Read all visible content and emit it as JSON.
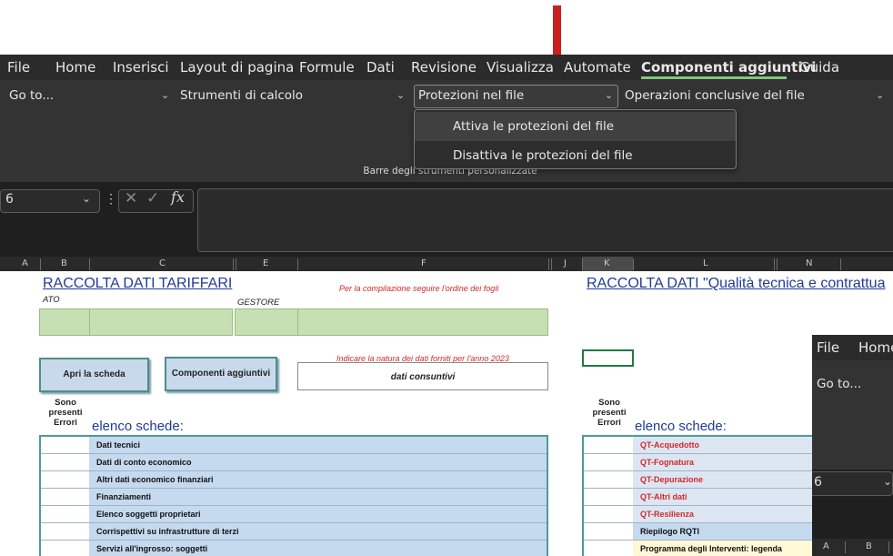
{
  "menubar": {
    "items": [
      "File",
      "Home",
      "Inserisci",
      "Layout di pagina",
      "Formule",
      "Dati",
      "Revisione",
      "Visualizza",
      "Automate",
      "Componenti aggiuntivi",
      "Guida"
    ],
    "active": "Componenti aggiuntivi"
  },
  "ribbon": {
    "dropdowns": [
      "Go to...",
      "Strumenti di calcolo",
      "Protezioni nel file",
      "Operazioni conclusive del file"
    ],
    "group_label": "Barre degli strumenti personalizzate",
    "menu_options": [
      "Attiva le protezioni del file",
      "Disattiva le protezioni del file"
    ]
  },
  "formula_bar": {
    "namebox_value": "6",
    "fx_label": "fx"
  },
  "columns": [
    "A",
    "B",
    "C",
    "E",
    "F",
    "J",
    "K",
    "L",
    "N"
  ],
  "sheet": {
    "title_left": "RACCOLTA DATI TARIFFARI",
    "title_right": "RACCOLTA DATI \"Qualità tecnica e contrattua",
    "note_order": "Per la compilazione seguire l'ordine dei fogli",
    "label_ato": "ATO",
    "label_gestore": "GESTORE",
    "note_nature": "Indicare la natura dei dati forniti per l'anno 2023",
    "nature_value": "dati consuntivi",
    "btn_open": "Apri la scheda",
    "btn_addins": "Componenti aggiuntivi",
    "errors_label": "Sono presenti Errori",
    "elenco_label": "elenco schede:",
    "left_list": [
      "Dati tecnici",
      "Dati di conto economico",
      "Altri dati economico finanziari",
      "Finanziamenti",
      "Elenco soggetti proprietari",
      "Corrispettivi su infrastrutture di terzi",
      "Servizi all'ingrosso: soggetti"
    ],
    "right_list": [
      {
        "label": "QT-Acquedotto",
        "color": "#d12a2a"
      },
      {
        "label": "QT-Fognatura",
        "color": "#d12a2a"
      },
      {
        "label": "QT-Depurazione",
        "color": "#d12a2a"
      },
      {
        "label": "QT-Altri dati",
        "color": "#d12a2a"
      },
      {
        "label": "QT-Resilienza",
        "color": "#d12a2a"
      },
      {
        "label": "Riepilogo RQTI",
        "color": "#111111"
      },
      {
        "label": "Programma degli Interventi: legenda",
        "color": "#111111"
      }
    ]
  },
  "mini_window": {
    "menu": [
      "File",
      "Home"
    ],
    "goto": "Go to...",
    "namebox_value": "6",
    "cols": [
      "A",
      "B"
    ]
  },
  "colors": {
    "accent_arrow": "#c8201e",
    "active_tab_underline": "#7fc97f",
    "list_fill_left": "#c5d9ef",
    "list_fill_right": "#dce6f2",
    "green_fill": "#c6dfb3"
  }
}
